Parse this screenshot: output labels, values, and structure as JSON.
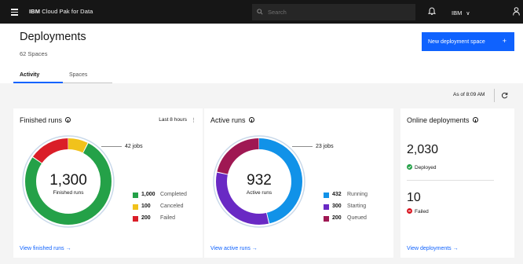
{
  "topbar": {
    "brand_prefix": "IBM",
    "brand_name": "Cloud Pak for Data",
    "search_placeholder": "Search",
    "account_label": "IBM"
  },
  "header": {
    "title": "Deployments",
    "subtitle": "62 Spaces",
    "new_button_label": "New deployment space",
    "new_button_icon": "+"
  },
  "tabs": [
    {
      "label": "Activity",
      "selected": true
    },
    {
      "label": "Spaces",
      "selected": false
    }
  ],
  "as_of": "As of 8:09 AM",
  "finished_runs": {
    "title": "Finished runs",
    "timeframe": "Last 8 hours",
    "total": "1,300",
    "total_label": "Finished runs",
    "callout": "42 jobs",
    "legend": [
      {
        "count": "1,000",
        "label": "Completed",
        "value": 1000,
        "color": "#24a148"
      },
      {
        "count": "100",
        "label": "Canceled",
        "value": 100,
        "color": "#f1c21b"
      },
      {
        "count": "200",
        "label": "Failed",
        "value": 200,
        "color": "#da1e28"
      }
    ],
    "link": "View finished runs"
  },
  "active_runs": {
    "title": "Active runs",
    "total": "932",
    "total_label": "Active runs",
    "callout": "23 jobs",
    "legend": [
      {
        "count": "432",
        "label": "Running",
        "value": 432,
        "color": "#1192e8"
      },
      {
        "count": "300",
        "label": "Starting",
        "value": 300,
        "color": "#6929c4"
      },
      {
        "count": "200",
        "label": "Queued",
        "value": 200,
        "color": "#9f1853"
      }
    ],
    "link": "View active runs"
  },
  "online_deployments": {
    "title": "Online deployments",
    "deployed_count": "2,030",
    "deployed_label": "Deployed",
    "failed_count": "10",
    "failed_label": "Failed",
    "link": "View deployments"
  },
  "colors": {
    "primary": "#0f62fe",
    "success": "#24a148",
    "danger": "#da1e28"
  }
}
